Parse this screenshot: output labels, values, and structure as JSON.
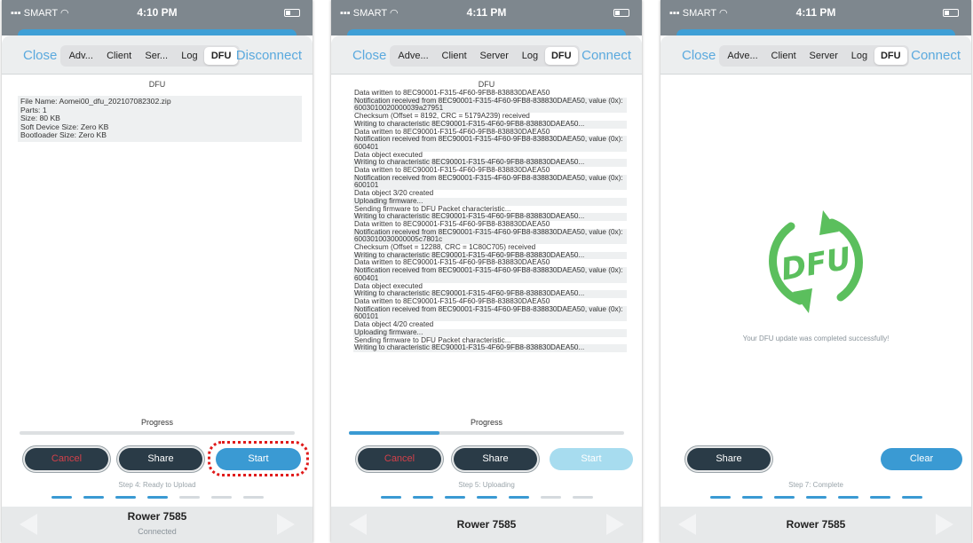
{
  "colors": {
    "accent": "#3a9ad3",
    "nav_link": "#5aa9de",
    "cancel": "#d2404a",
    "dfu_green": "#5bbf5d",
    "highlight_ring": "#e01a1a"
  },
  "status_bar": {
    "carrier": "SMART",
    "times": [
      "4:10 PM",
      "4:11 PM",
      "4:11 PM"
    ]
  },
  "nav": {
    "close": "Close",
    "screen1_tabs": [
      "Adv...",
      "Client",
      "Ser...",
      "Log",
      "DFU"
    ],
    "screen23_tabs": [
      "Adve...",
      "Client",
      "Server",
      "Log",
      "DFU"
    ],
    "disconnect": "Disconnect",
    "connect": "Connect",
    "active_tab": "DFU"
  },
  "screen1": {
    "title": "DFU",
    "file_info": [
      "File Name: Aomei00_dfu_202107082302.zip",
      "Parts: 1",
      "Size: 80 KB",
      "Soft Device Size: Zero KB",
      "Bootloader Size: Zero KB"
    ],
    "progress_label": "Progress",
    "progress": 0,
    "buttons": {
      "cancel": "Cancel",
      "share": "Share",
      "start": "Start"
    },
    "step_text": "Step 4: Ready to Upload",
    "steps_done": 4,
    "steps_total": 7,
    "device_name": "Rower 7585",
    "connection": "Connected"
  },
  "screen2": {
    "title": "DFU",
    "log": [
      "Data written to 8EC90001-F315-4F60-9FB8-838830DAEA50",
      "Notification received from 8EC90001-F315-4F60-9FB8-838830DAEA50, value (0x): 6003010020000039a27951",
      "Checksum (Offset = 8192, CRC = 5179A239) received",
      "Writing to characteristic 8EC90001-F315-4F60-9FB8-838830DAEA50...",
      "Data written to 8EC90001-F315-4F60-9FB8-838830DAEA50",
      "Notification received from 8EC90001-F315-4F60-9FB8-838830DAEA50, value (0x): 600401",
      "Data object executed",
      "Writing to characteristic 8EC90001-F315-4F60-9FB8-838830DAEA50...",
      "Data written to 8EC90001-F315-4F60-9FB8-838830DAEA50",
      "Notification received from 8EC90001-F315-4F60-9FB8-838830DAEA50, value (0x): 600101",
      "Data object 3/20 created",
      "Uploading firmware...",
      "Sending firmware to DFU Packet characteristic...",
      "Writing to characteristic 8EC90001-F315-4F60-9FB8-838830DAEA50...",
      "Data written to 8EC90001-F315-4F60-9FB8-838830DAEA50",
      "Notification received from 8EC90001-F315-4F60-9FB8-838830DAEA50, value (0x): 6003010030000005c7801c",
      "Checksum (Offset = 12288, CRC = 1C80C705) received",
      "Writing to characteristic 8EC90001-F315-4F60-9FB8-838830DAEA50...",
      "Data written to 8EC90001-F315-4F60-9FB8-838830DAEA50",
      "Notification received from 8EC90001-F315-4F60-9FB8-838830DAEA50, value (0x): 600401",
      "Data object executed",
      "Writing to characteristic 8EC90001-F315-4F60-9FB8-838830DAEA50...",
      "Data written to 8EC90001-F315-4F60-9FB8-838830DAEA50",
      "Notification received from 8EC90001-F315-4F60-9FB8-838830DAEA50, value (0x): 600101",
      "Data object 4/20 created",
      "Uploading firmware...",
      "Sending firmware to DFU Packet characteristic...",
      "Writing to characteristic 8EC90001-F315-4F60-9FB8-838830DAEA50..."
    ],
    "progress_label": "Progress",
    "progress": 0.33,
    "buttons": {
      "cancel": "Cancel",
      "share": "Share",
      "start": "Start"
    },
    "step_text": "Step 5: Uploading",
    "steps_done": 5,
    "steps_total": 7,
    "device_name": "Rower 7585"
  },
  "screen3": {
    "logo_text": "DFU",
    "success_message": "Your DFU update was completed successfully!",
    "buttons": {
      "share": "Share",
      "clear": "Clear"
    },
    "step_text": "Step 7: Complete",
    "steps_done": 7,
    "steps_total": 7,
    "device_name": "Rower 7585"
  }
}
